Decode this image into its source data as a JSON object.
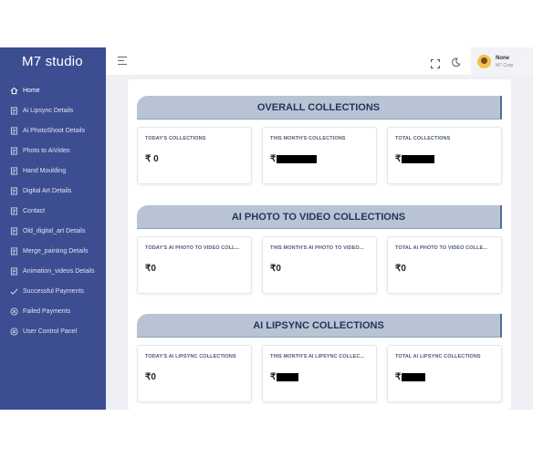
{
  "app": {
    "title": "M7 studio"
  },
  "sidebar": {
    "items": [
      {
        "label": "Home",
        "icon": "home-icon"
      },
      {
        "label": "Ai Lipsync Details",
        "icon": "document-icon"
      },
      {
        "label": "Ai PhotoShoot Details",
        "icon": "document-icon"
      },
      {
        "label": "Photo to AiVideo",
        "icon": "document-icon"
      },
      {
        "label": "Hand Moulding",
        "icon": "document-icon"
      },
      {
        "label": "Digital Art Details",
        "icon": "document-icon"
      },
      {
        "label": "Contact",
        "icon": "document-icon"
      },
      {
        "label": "Old_digital_art Details",
        "icon": "document-icon"
      },
      {
        "label": "Merge_painting Details",
        "icon": "document-icon"
      },
      {
        "label": "Animation_videos Details",
        "icon": "document-icon"
      },
      {
        "label": "Successful Payments",
        "icon": "check-icon"
      },
      {
        "label": "Failed Payments",
        "icon": "x-circle-icon"
      },
      {
        "label": "User Control Panel",
        "icon": "x-circle-icon"
      }
    ]
  },
  "topbar": {
    "user_name": "None",
    "user_org": "M7 Corp"
  },
  "sections": [
    {
      "title": "OVERALL COLLECTIONS",
      "cards": [
        {
          "label": "TODAY'S COLLECTIONS",
          "value": "₹ 0"
        },
        {
          "label": "THIS MONTH'S COLLECTIONS",
          "value": "₹"
        },
        {
          "label": "TOTAL COLLECTIONS",
          "value": "₹"
        }
      ]
    },
    {
      "title": "AI PHOTO TO VIDEO COLLECTIONS",
      "cards": [
        {
          "label": "TODAY'S AI PHOTO TO VIDEO COLL...",
          "value": "₹0"
        },
        {
          "label": "THIS MONTH'S AI PHOTO TO VIDEO...",
          "value": "₹0"
        },
        {
          "label": "TOTAL AI PHOTO TO VIDEO COLLE...",
          "value": "₹0"
        }
      ]
    },
    {
      "title": "AI LIPSYNC COLLECTIONS",
      "cards": [
        {
          "label": "TODAY'S AI LIPSYNC COLLECTIONS",
          "value": "₹0"
        },
        {
          "label": "THIS MONTH'S AI LIPSYNC COLLEC...",
          "value": "₹"
        },
        {
          "label": "TOTAL AI LIPSYNC COLLECTIONS",
          "value": "₹"
        }
      ]
    }
  ],
  "colors": {
    "sidebar_bg": "#3d4d92",
    "ribbon_bg": "#b8c4d3",
    "ribbon_text": "#22355d",
    "content_bg": "#eef0f6"
  }
}
